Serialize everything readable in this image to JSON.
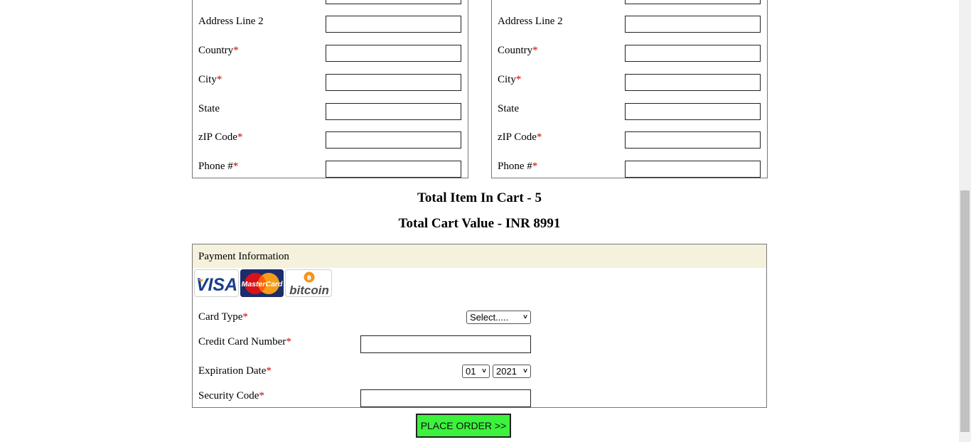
{
  "billing": {
    "address2_label": "Address Line 2",
    "country_label": "Country",
    "city_label": "City",
    "state_label": "State",
    "zip_label": "zIP Code",
    "phone_label": "Phone #",
    "required_mark": "*"
  },
  "shipping": {
    "address2_label": "Address Line 2",
    "country_label": "Country",
    "city_label": "City",
    "state_label": "State",
    "zip_label": "zIP Code",
    "phone_label": "Phone #",
    "required_mark": "*"
  },
  "summary": {
    "total_items": "Total Item In Cart - 5",
    "total_value": "Total Cart Value - INR 8991"
  },
  "payment": {
    "title": "Payment Information",
    "logos": {
      "visa": "VISA",
      "mastercard": "MasterCard",
      "bitcoin": "bitcoin"
    },
    "card_type_label": "Card Type",
    "card_type_value": "Select.....",
    "card_number_label": "Credit Card Number",
    "expiration_label": "Expiration Date",
    "exp_month": "01",
    "exp_year": "2021",
    "security_label": "Security Code",
    "required_mark": "*"
  },
  "actions": {
    "place_order": "PLACE ORDER >>"
  },
  "colors": {
    "required": "#d00000",
    "button": "#3cf23c",
    "payment_header": "#f4f2dc"
  }
}
